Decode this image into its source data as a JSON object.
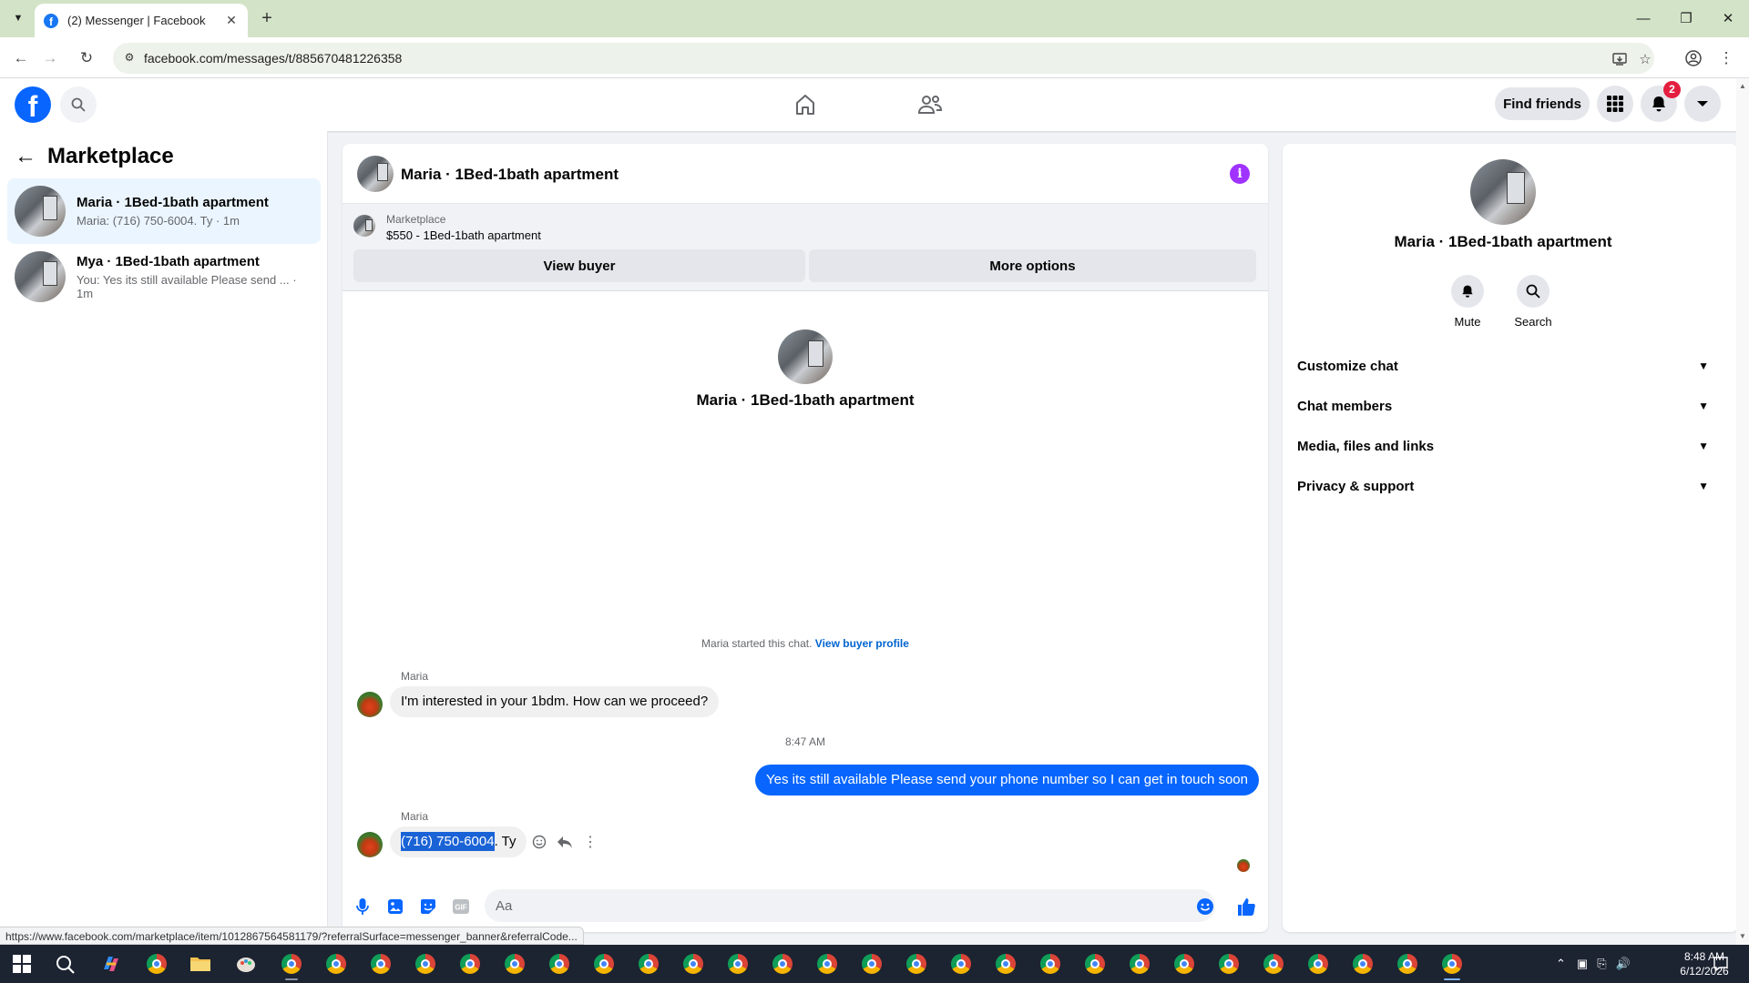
{
  "browser": {
    "tab_title": "(2) Messenger | Facebook",
    "url": "facebook.com/messages/t/885670481226358",
    "status_url": "https://www.facebook.com/marketplace/item/1012867564581179/?referralSurface=messenger_banner&referralCode..."
  },
  "header": {
    "logo": "f",
    "find_friends": "Find friends",
    "notification_count": "2"
  },
  "sidebar": {
    "title": "Marketplace",
    "conversations": [
      {
        "name": "Maria · 1Bed-1bath apartment",
        "preview": "Maria: (716) 750-6004. Ty · 1m",
        "active": true
      },
      {
        "name": "Mya · 1Bed-1bath apartment",
        "preview": "You: Yes its still available Please send ... · 1m",
        "active": false
      }
    ]
  },
  "chat": {
    "title": "Maria · 1Bed-1bath apartment",
    "info_icon": "i",
    "banner": {
      "source": "Marketplace",
      "item": "$550 - 1Bed-1bath apartment",
      "view_buyer": "View buyer",
      "more_options": "More options"
    },
    "intro_name": "Maria · 1Bed-1bath apartment",
    "started_text": "Maria started this chat.",
    "view_buyer_profile": "View buyer profile",
    "messages": [
      {
        "sender": "Maria",
        "text": "I'm interested in your 1bdm. How can we proceed?"
      },
      {
        "timestamp": "8:47 AM"
      },
      {
        "sender": "You",
        "text": "Yes its still available Please send your phone number so I can get in touch soon"
      },
      {
        "sender": "Maria",
        "text_selected": "(716) 750-6004",
        "text_rest": ". Ty"
      }
    ],
    "composer_placeholder": "Aa"
  },
  "info_panel": {
    "name": "Maria · 1Bed-1bath apartment",
    "mute": "Mute",
    "search": "Search",
    "sections": [
      "Customize chat",
      "Chat members",
      "Media, files and links",
      "Privacy & support"
    ]
  },
  "taskbar": {
    "time": "8:48 AM",
    "date": "6/12/2026"
  },
  "colors": {
    "fb_blue": "#0866ff",
    "badge_red": "#e41e3f",
    "info_purple": "#a033ff",
    "active_row": "#ebf5ff"
  }
}
